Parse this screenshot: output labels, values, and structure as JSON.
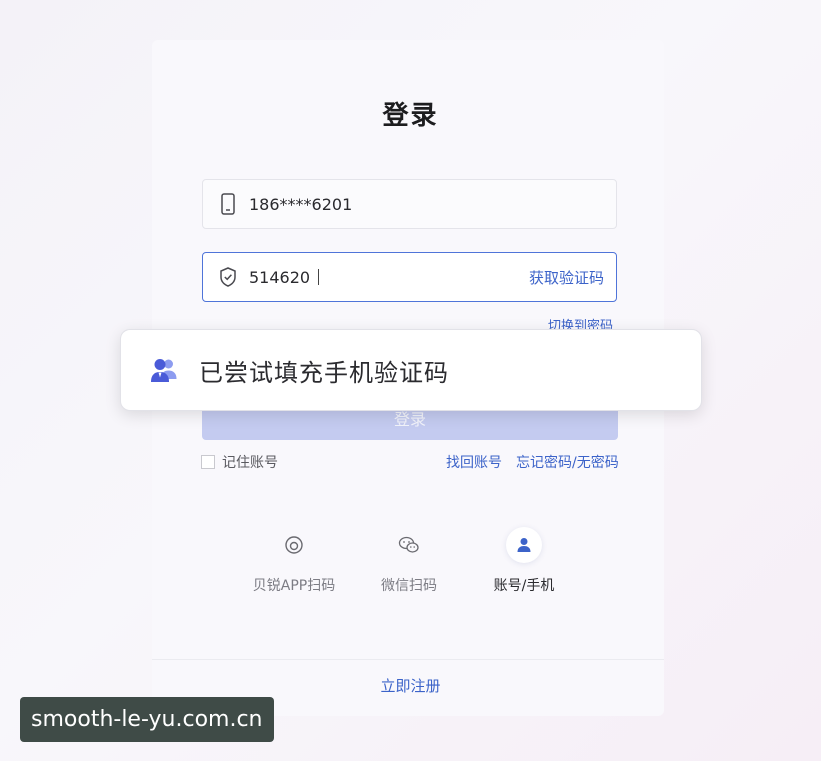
{
  "page": {
    "title": "登录"
  },
  "form": {
    "phone_value": "186****6201",
    "code_value": "514620",
    "get_code_label": "获取验证码",
    "switch_password_label": "切换到密码",
    "login_button_label": "登录",
    "remember_label": "记住账号",
    "find_account_label": "找回账号",
    "forgot_password_label": "忘记密码/无密码"
  },
  "methods": [
    {
      "label": "贝锐APP扫码",
      "icon": "app-scan-icon",
      "active": false
    },
    {
      "label": "微信扫码",
      "icon": "wechat-icon",
      "active": false
    },
    {
      "label": "账号/手机",
      "icon": "user-icon",
      "active": true
    }
  ],
  "footer": {
    "register_label": "立即注册"
  },
  "toast": {
    "text": "已尝试填充手机验证码",
    "icon": "user-group-icon"
  },
  "watermark": {
    "text": "smooth-le-yu.com.cn"
  },
  "colors": {
    "accent": "#3c63c9",
    "button_disabled": "#c4cbf0",
    "toast_icon": "#4a5bd8"
  }
}
